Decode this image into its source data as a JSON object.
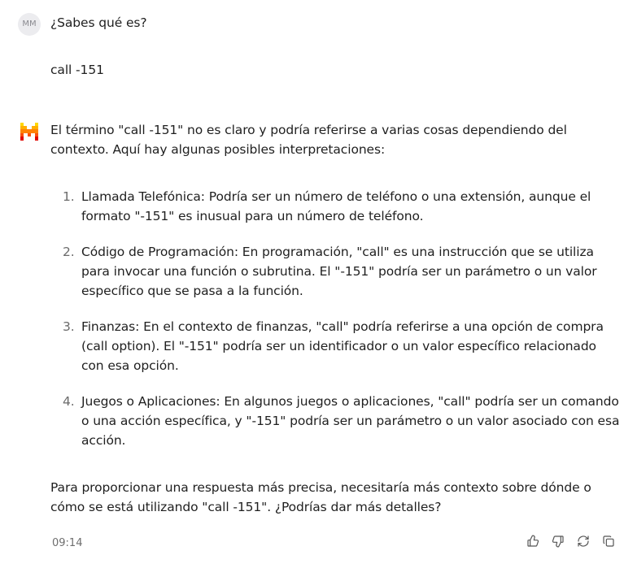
{
  "user": {
    "avatar_initials": "MM",
    "message_lines": [
      "¿Sabes qué es?",
      "call -151"
    ]
  },
  "assistant": {
    "intro": "El término \"call -151\" no es claro y podría referirse a varias cosas dependiendo del contexto. Aquí hay algunas posibles interpretaciones:",
    "items": [
      {
        "number": "1.",
        "text": "Llamada Telefónica: Podría ser un número de teléfono o una extensión, aunque el formato \"-151\" es inusual para un número de teléfono."
      },
      {
        "number": "2.",
        "text": "Código de Programación: En programación, \"call\" es una instrucción que se utiliza para invocar una función o subrutina. El \"-151\" podría ser un parámetro o un valor específico que se pasa a la función."
      },
      {
        "number": "3.",
        "text": "Finanzas: En el contexto de finanzas, \"call\" podría referirse a una opción de compra (call option). El \"-151\" podría ser un identificador o un valor específico relacionado con esa opción."
      },
      {
        "number": "4.",
        "text": "Juegos o Aplicaciones: En algunos juegos o aplicaciones, \"call\" podría ser un comando o una acción específica, y \"-151\" podría ser un parámetro o un valor asociado con esa acción."
      }
    ],
    "closing": "Para proporcionar una respuesta más precisa, necesitaría más contexto sobre dónde o cómo se está utilizando \"call -151\". ¿Podrías dar más detalles?",
    "timestamp": "09:14"
  },
  "icons": {
    "logo": "mistral-logo-icon",
    "actions": [
      "thumbs-up-icon",
      "thumbs-down-icon",
      "regenerate-icon",
      "copy-icon"
    ]
  },
  "colors": {
    "logo_orange": "#f7931e",
    "logo_red": "#e4301d",
    "logo_yellow": "#ffcb21",
    "text": "#1f1f1f",
    "muted": "#6e6e6e",
    "avatar_bg": "#ececef"
  }
}
